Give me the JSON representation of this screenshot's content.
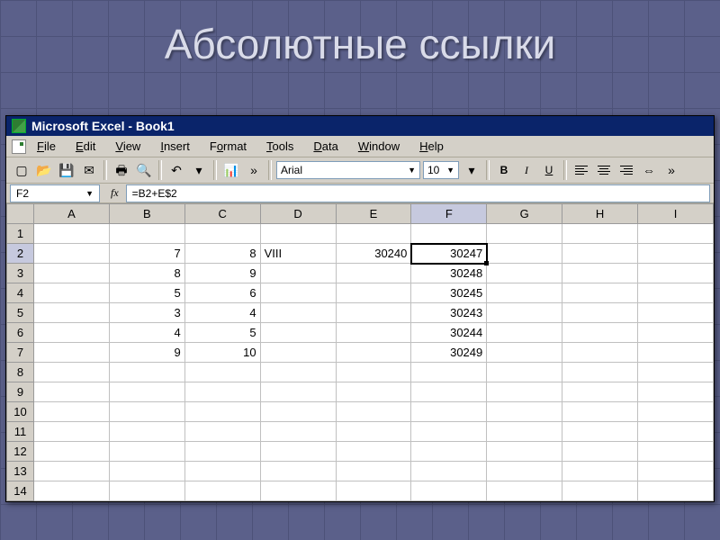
{
  "slide": {
    "title": "Абсолютные ссылки"
  },
  "titlebar": {
    "text": "Microsoft Excel - Book1"
  },
  "menu": {
    "file": "File",
    "edit": "Edit",
    "view": "View",
    "insert": "Insert",
    "format": "Format",
    "tools": "Tools",
    "data": "Data",
    "window": "Window",
    "help": "Help"
  },
  "toolbar": {
    "font": "Arial",
    "size": "10",
    "bold": "B",
    "italic": "I",
    "underline": "U"
  },
  "formula": {
    "namebox": "F2",
    "fx_label": "fx",
    "value": "=B2+E$2"
  },
  "grid": {
    "columns": [
      "A",
      "B",
      "C",
      "D",
      "E",
      "F",
      "G",
      "H",
      "I"
    ],
    "active_col": "F",
    "active_row": "2",
    "rows": [
      {
        "n": "1",
        "cells": [
          "",
          "",
          "",
          "",
          "",
          "",
          "",
          "",
          ""
        ]
      },
      {
        "n": "2",
        "cells": [
          "",
          "7",
          "8",
          "VIII",
          "30240",
          "30247",
          "",
          "",
          ""
        ]
      },
      {
        "n": "3",
        "cells": [
          "",
          "8",
          "9",
          "",
          "",
          "30248",
          "",
          "",
          ""
        ]
      },
      {
        "n": "4",
        "cells": [
          "",
          "5",
          "6",
          "",
          "",
          "30245",
          "",
          "",
          ""
        ]
      },
      {
        "n": "5",
        "cells": [
          "",
          "3",
          "4",
          "",
          "",
          "30243",
          "",
          "",
          ""
        ]
      },
      {
        "n": "6",
        "cells": [
          "",
          "4",
          "5",
          "",
          "",
          "30244",
          "",
          "",
          ""
        ]
      },
      {
        "n": "7",
        "cells": [
          "",
          "9",
          "10",
          "",
          "",
          "30249",
          "",
          "",
          ""
        ]
      },
      {
        "n": "8",
        "cells": [
          "",
          "",
          "",
          "",
          "",
          "",
          "",
          "",
          ""
        ]
      },
      {
        "n": "9",
        "cells": [
          "",
          "",
          "",
          "",
          "",
          "",
          "",
          "",
          ""
        ]
      },
      {
        "n": "10",
        "cells": [
          "",
          "",
          "",
          "",
          "",
          "",
          "",
          "",
          ""
        ]
      },
      {
        "n": "11",
        "cells": [
          "",
          "",
          "",
          "",
          "",
          "",
          "",
          "",
          ""
        ]
      },
      {
        "n": "12",
        "cells": [
          "",
          "",
          "",
          "",
          "",
          "",
          "",
          "",
          ""
        ]
      },
      {
        "n": "13",
        "cells": [
          "",
          "",
          "",
          "",
          "",
          "",
          "",
          "",
          ""
        ]
      },
      {
        "n": "14",
        "cells": [
          "",
          "",
          "",
          "",
          "",
          "",
          "",
          "",
          ""
        ]
      }
    ],
    "left_align_cols": [
      "D"
    ]
  }
}
